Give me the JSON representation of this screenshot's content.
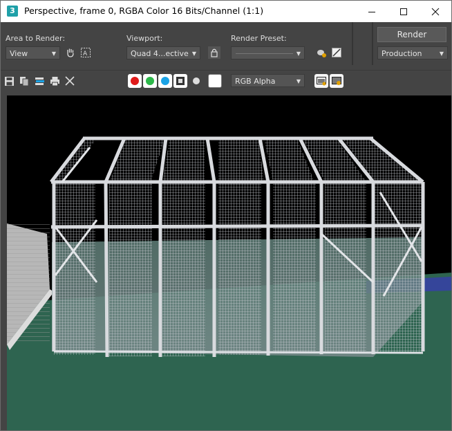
{
  "window": {
    "title": "Perspective, frame 0, RGBA Color 16 Bits/Channel (1:1)",
    "app_icon": "3"
  },
  "toolbar": {
    "area_label": "Area to Render:",
    "area_value": "View",
    "viewport_label": "Viewport:",
    "viewport_value": "Quad 4...ective",
    "preset_label": "Render Preset:",
    "preset_value": "",
    "render_button": "Render",
    "production_value": "Production"
  },
  "channel": {
    "display_value": "RGB Alpha"
  },
  "colors": {
    "red_channel": "#e01b1b",
    "green_channel": "#2db84a",
    "blue_channel": "#1ba3e6",
    "ground": "#2e6450",
    "background": "#000000"
  }
}
